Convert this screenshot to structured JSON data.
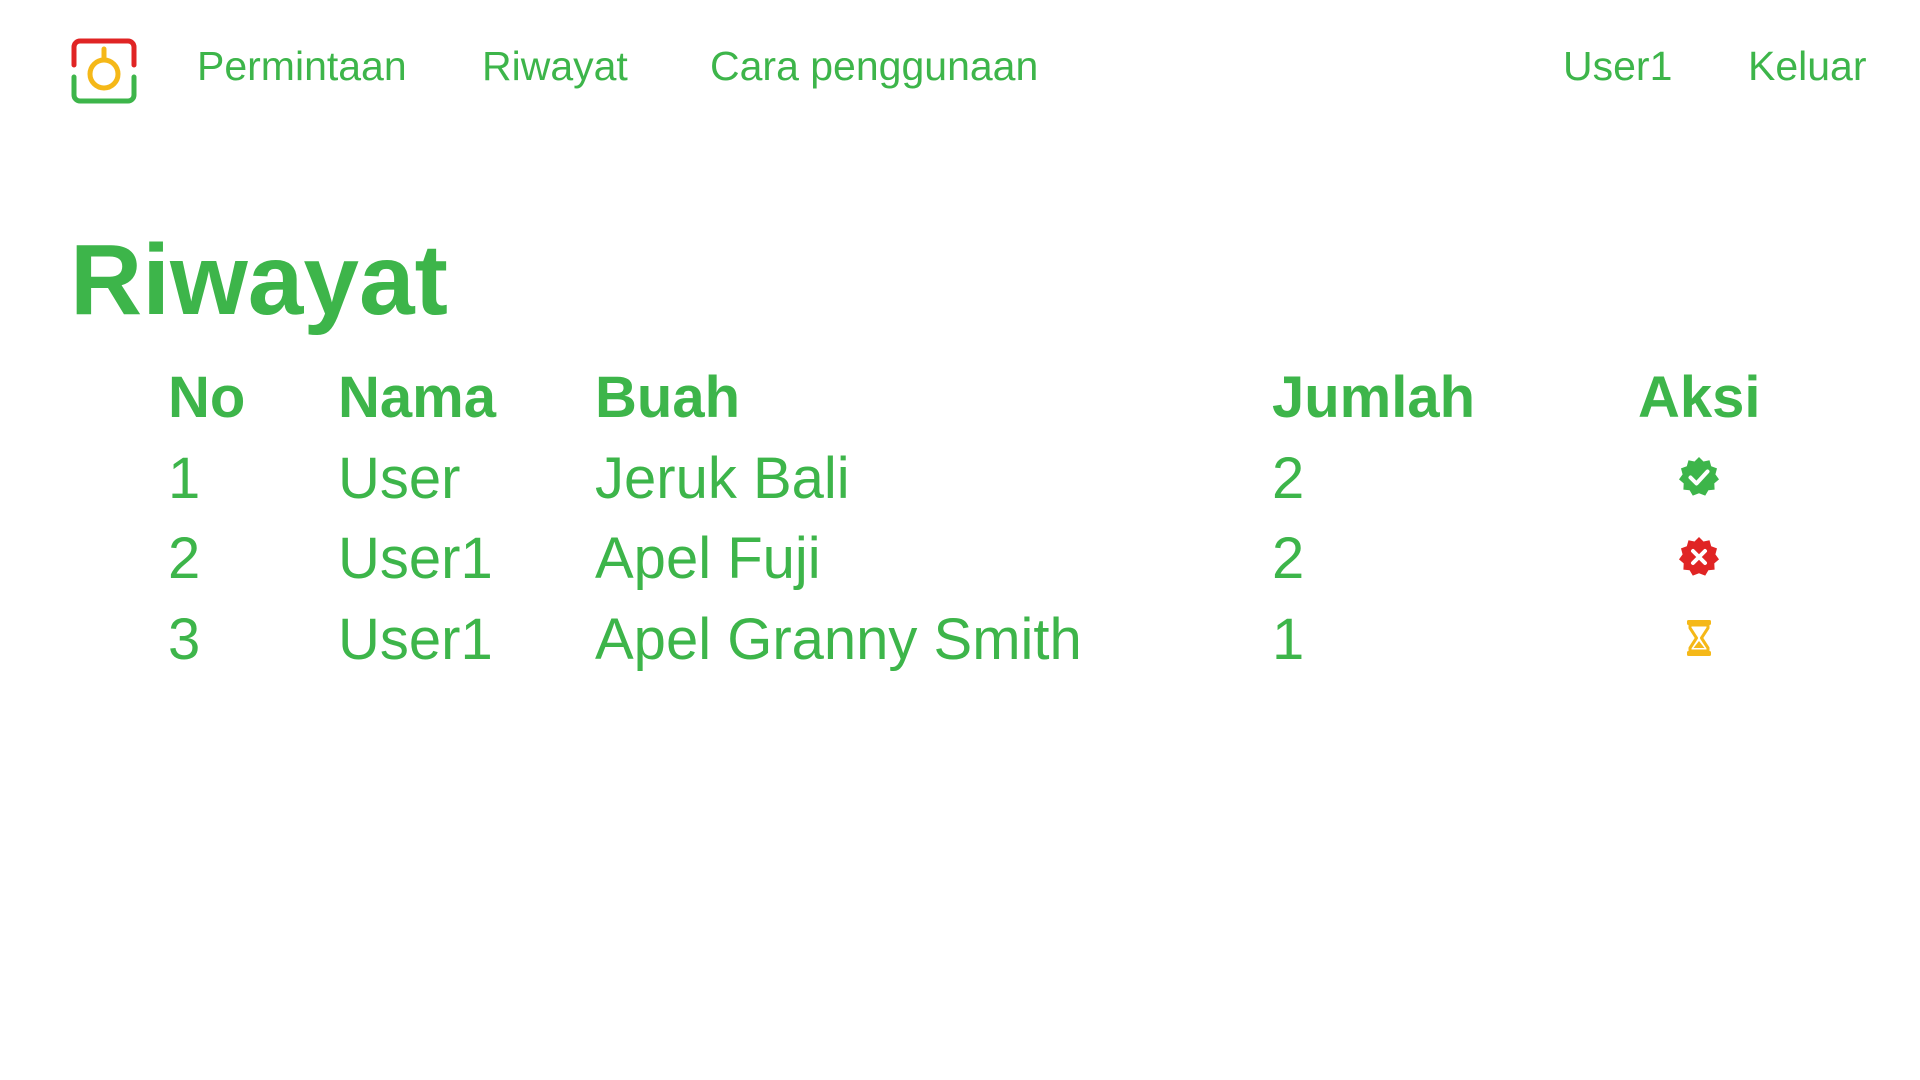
{
  "nav": {
    "links": [
      "Permintaan",
      "Riwayat",
      "Cara penggunaan"
    ],
    "user": "User1",
    "logout": "Keluar"
  },
  "page": {
    "title": "Riwayat"
  },
  "table": {
    "headers": [
      "No",
      "Nama",
      "Buah",
      "Jumlah",
      "Aksi"
    ],
    "rows": [
      {
        "no": "1",
        "nama": "User",
        "buah": "Jeruk Bali",
        "jumlah": "2",
        "status_icon": "check-badge-icon",
        "status_color": "#3db54a"
      },
      {
        "no": "2",
        "nama": "User1",
        "buah": "Apel Fuji",
        "jumlah": "2",
        "status_icon": "x-badge-icon",
        "status_color": "#e02424"
      },
      {
        "no": "3",
        "nama": "User1",
        "buah": "Apel Granny Smith",
        "jumlah": "1",
        "status_icon": "hourglass-icon",
        "status_color": "#f5b818"
      }
    ]
  },
  "colors": {
    "primary": "#3db54a",
    "logo_red": "#e02424",
    "logo_yellow": "#f5b818",
    "logo_green": "#3db54a"
  }
}
